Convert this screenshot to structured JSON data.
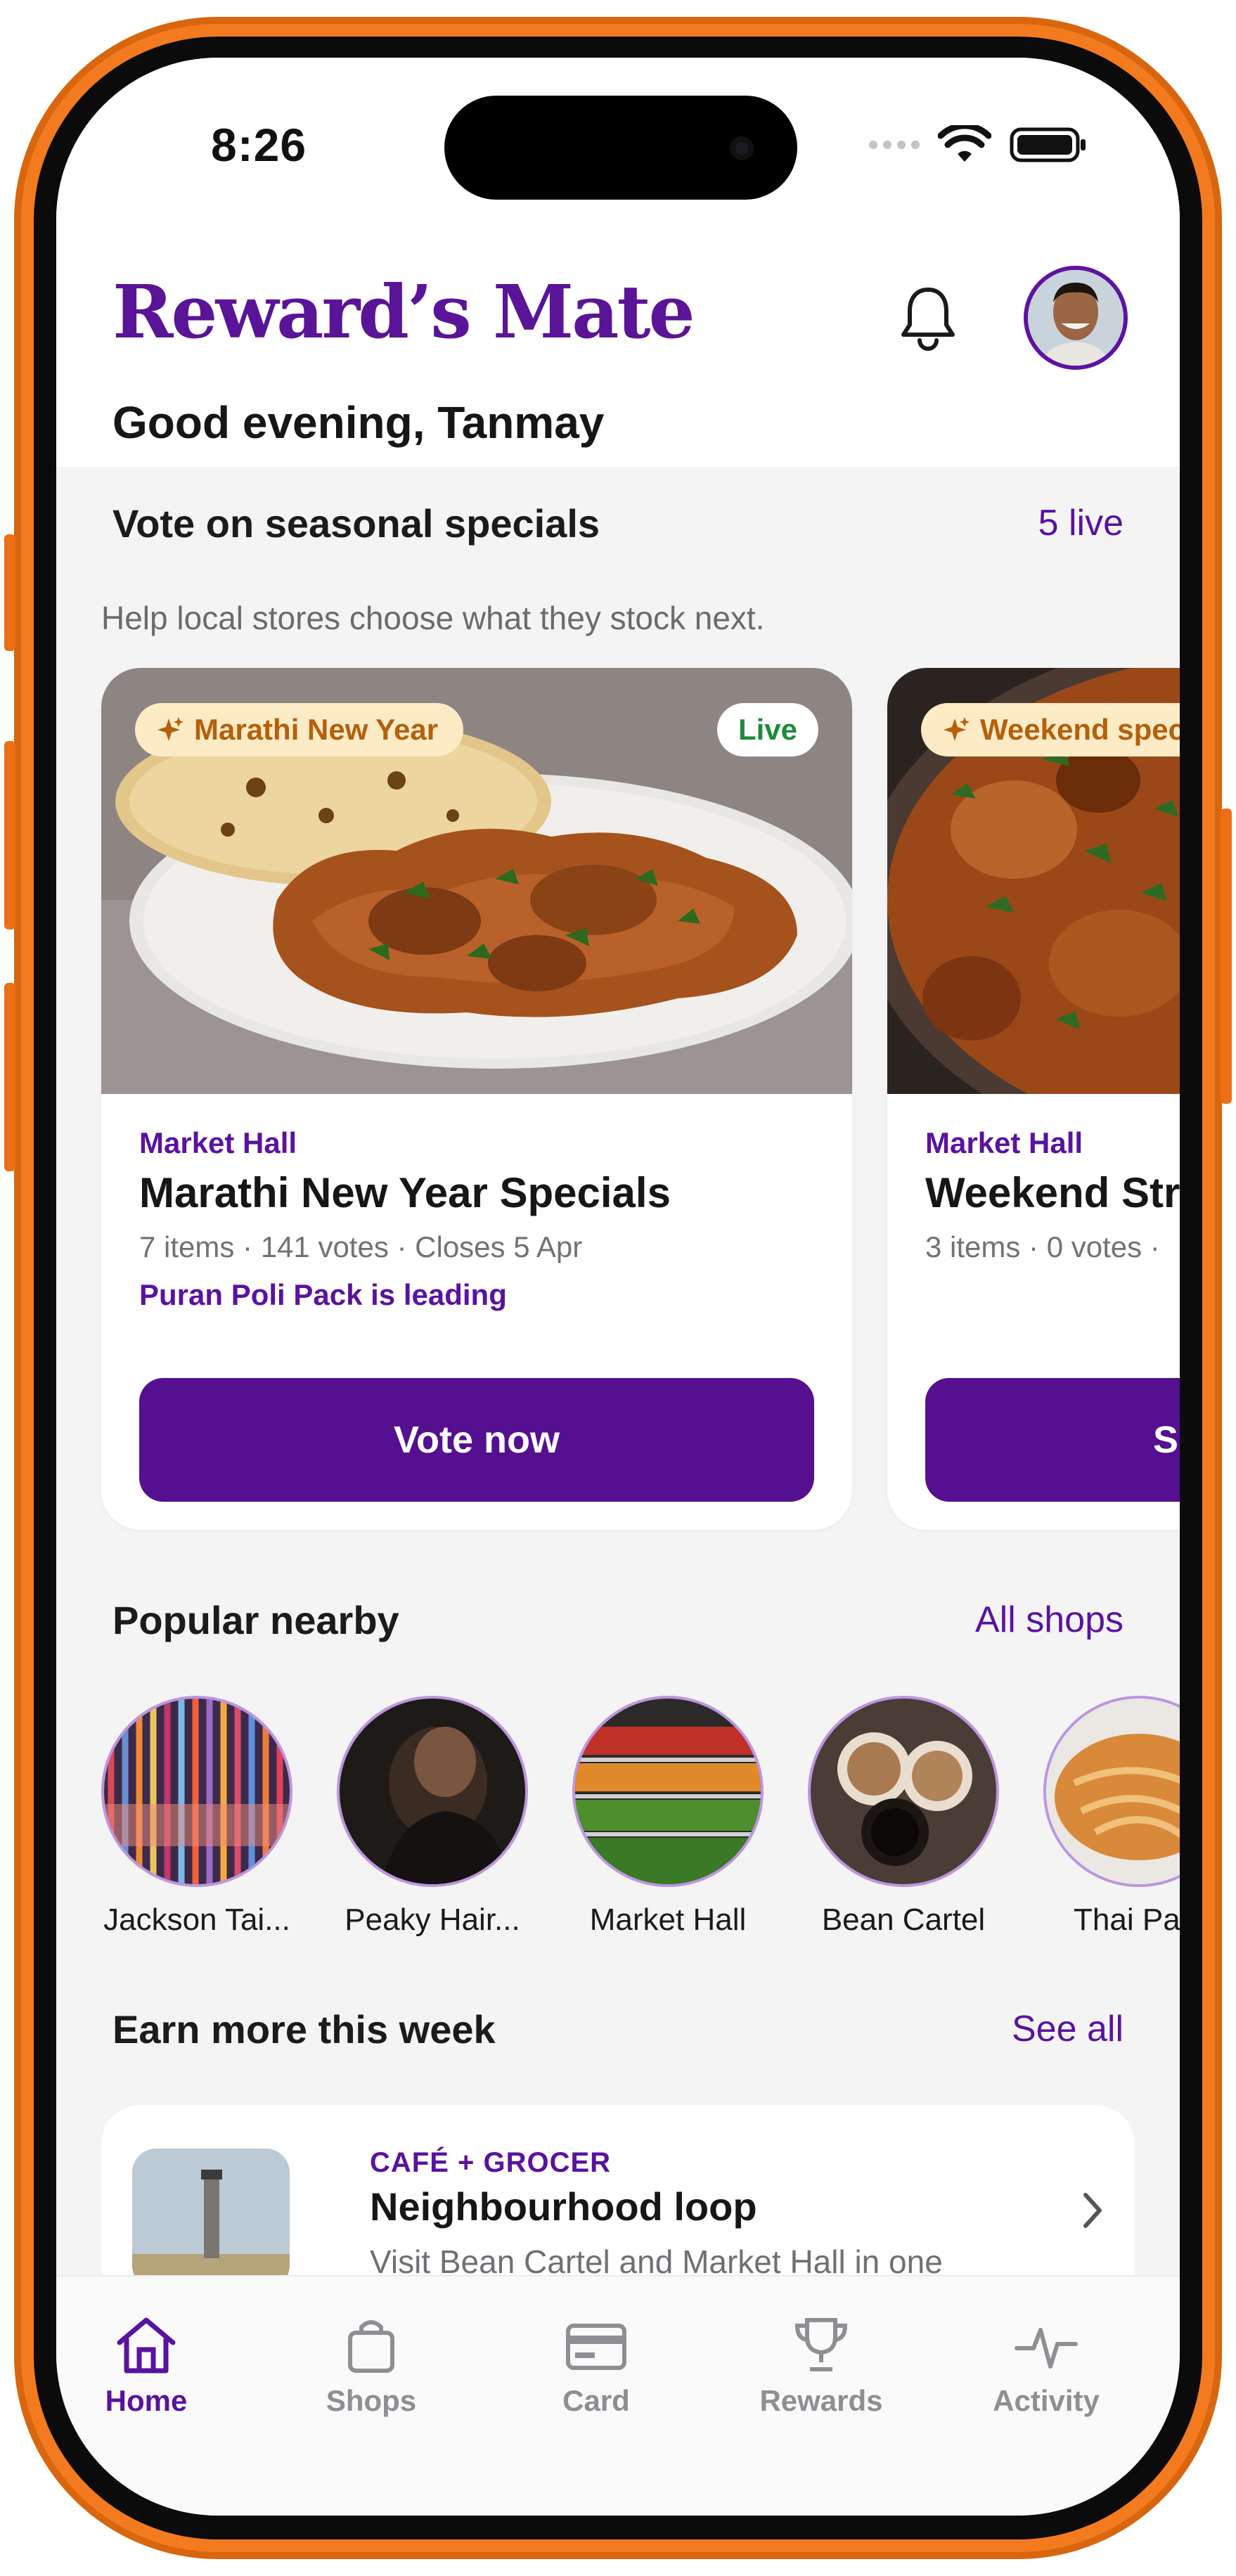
{
  "status_bar": {
    "time": "8:26"
  },
  "header": {
    "brand": "Reward’s Mate",
    "greeting": "Good evening, Tanmay"
  },
  "seasonal": {
    "title": "Vote on seasonal specials",
    "live_count": "5 live",
    "subtitle": "Help local stores choose what they stock next.",
    "cards": [
      {
        "tag": "Marathi New Year",
        "status": "Live",
        "store": "Market Hall",
        "title": "Marathi New Year Specials",
        "meta": "7 items · 141 votes · Closes 5 Apr",
        "leading": "Puran Poli Pack is leading",
        "button": "Vote now"
      },
      {
        "tag": "Weekend spec",
        "store": "Market Hall",
        "title": "Weekend Str",
        "meta": "3 items · 0 votes ·",
        "button": "S"
      }
    ]
  },
  "popular": {
    "title": "Popular nearby",
    "link": "All shops",
    "shops": [
      {
        "name": "Jackson Tai..."
      },
      {
        "name": "Peaky Hair..."
      },
      {
        "name": "Market Hall"
      },
      {
        "name": "Bean Cartel"
      },
      {
        "name": "Thai Pala"
      }
    ]
  },
  "earn": {
    "title": "Earn more this week",
    "link": "See all",
    "card": {
      "kicker": "CAFÉ + GROCER",
      "title": "Neighbourhood loop",
      "desc": "Visit Bean Cartel and Market Hall in one"
    }
  },
  "tabbar": {
    "tabs": [
      {
        "label": "Home",
        "icon": "home-icon",
        "active": true
      },
      {
        "label": "Shops",
        "icon": "shopping-bag-icon"
      },
      {
        "label": "Card",
        "icon": "card-icon"
      },
      {
        "label": "Rewards",
        "icon": "trophy-icon"
      },
      {
        "label": "Activity",
        "icon": "activity-icon"
      }
    ]
  },
  "colors": {
    "brand": "#5a1497",
    "accent": "#55108f",
    "frame": "#f47a1f",
    "tag_bg": "#fdebc6",
    "live_green": "#1f8a3a"
  }
}
